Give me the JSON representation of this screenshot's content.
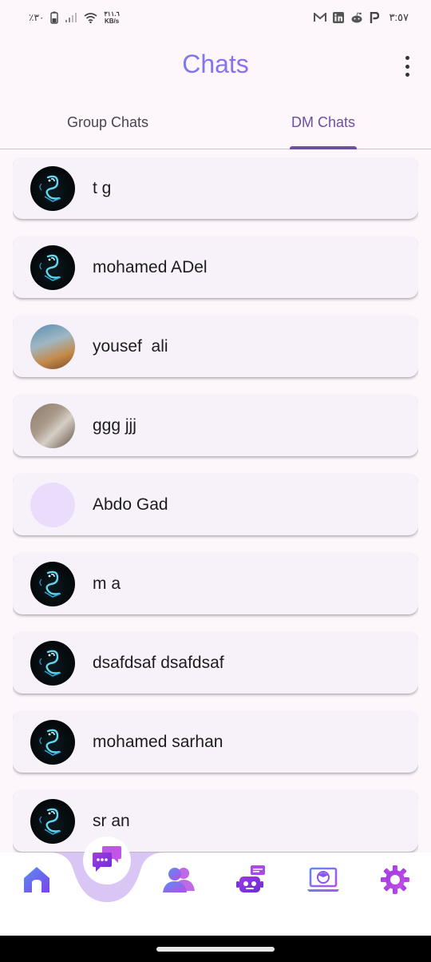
{
  "status_bar": {
    "battery": "٪٣٠",
    "speed_value": "٣١١.٦",
    "speed_unit": "KB/s",
    "time": "٣:٥٧"
  },
  "header": {
    "title": "Chats"
  },
  "tabs": [
    {
      "label": "Group Chats",
      "active": false
    },
    {
      "label": "DM Chats",
      "active": true
    }
  ],
  "chats": [
    {
      "name": "t g",
      "avatar": "dragon"
    },
    {
      "name": "mohamed ADel",
      "avatar": "dragon"
    },
    {
      "name": "yousef  ali",
      "avatar": "photo"
    },
    {
      "name": "ggg jjj",
      "avatar": "photo"
    },
    {
      "name": "Abdo Gad",
      "avatar": "blank"
    },
    {
      "name": "m a",
      "avatar": "dragon"
    },
    {
      "name": "dsafdsaf dsafdsaf",
      "avatar": "dragon"
    },
    {
      "name": "mohamed sarhan",
      "avatar": "dragon"
    },
    {
      "name": "sr an",
      "avatar": "dragon"
    }
  ],
  "bottom_nav": [
    {
      "icon": "home-icon"
    },
    {
      "icon": "chat-bubbles-icon",
      "active": true
    },
    {
      "icon": "people-icon"
    },
    {
      "icon": "robot-chat-icon"
    },
    {
      "icon": "laptop-graduation-icon"
    },
    {
      "icon": "settings-gear-icon"
    }
  ],
  "colors": {
    "accent": "#6d4fa3",
    "title_gradient": [
      "#4a9be8",
      "#b75ce6"
    ],
    "background": "#fdf7fc",
    "card": "#f7f2f9"
  }
}
